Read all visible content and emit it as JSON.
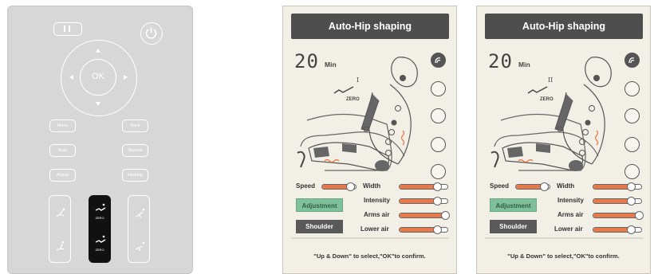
{
  "remote": {
    "ok_label": "OK",
    "buttons": [
      "Menu",
      "Back",
      "Auto",
      "Manual",
      "Adjust",
      "Heating"
    ],
    "zero_label": "ZERO"
  },
  "panels": [
    {
      "title": "Auto-Hip shaping",
      "time_value": "20",
      "time_unit": "Min",
      "zero_label": "ZERO",
      "zero_stage": "I",
      "speed_label": "Speed",
      "speed_level": 0.8,
      "width_label": "Width",
      "width_level": 0.75,
      "intensity_label": "Intensity",
      "intensity_level": 0.75,
      "arms_air_label": "Arms air",
      "arms_air_level": 0.92,
      "lower_air_label": "Lower air",
      "lower_air_level": 0.75,
      "adjustment_label": "Adjustment",
      "shoulder_label": "Shoulder",
      "hint": "\"Up & Down\" to select,\"OK\"to confirm."
    },
    {
      "title": "Auto-Hip shaping",
      "time_value": "20",
      "time_unit": "Min",
      "zero_label": "ZERO",
      "zero_stage": "II",
      "speed_label": "Speed",
      "speed_level": 0.8,
      "width_label": "Width",
      "width_level": 0.75,
      "intensity_label": "Intensity",
      "intensity_level": 0.75,
      "arms_air_label": "Arms air",
      "arms_air_level": 0.92,
      "lower_air_label": "Lower air",
      "lower_air_level": 0.75,
      "adjustment_label": "Adjustment",
      "shoulder_label": "Shoulder",
      "hint": "\"Up & Down\" to select,\"OK\"to confirm."
    }
  ],
  "colors": {
    "accent": "#e8794a",
    "adjustment": "#7fbf9a",
    "title_bar": "#4e4e4e"
  }
}
